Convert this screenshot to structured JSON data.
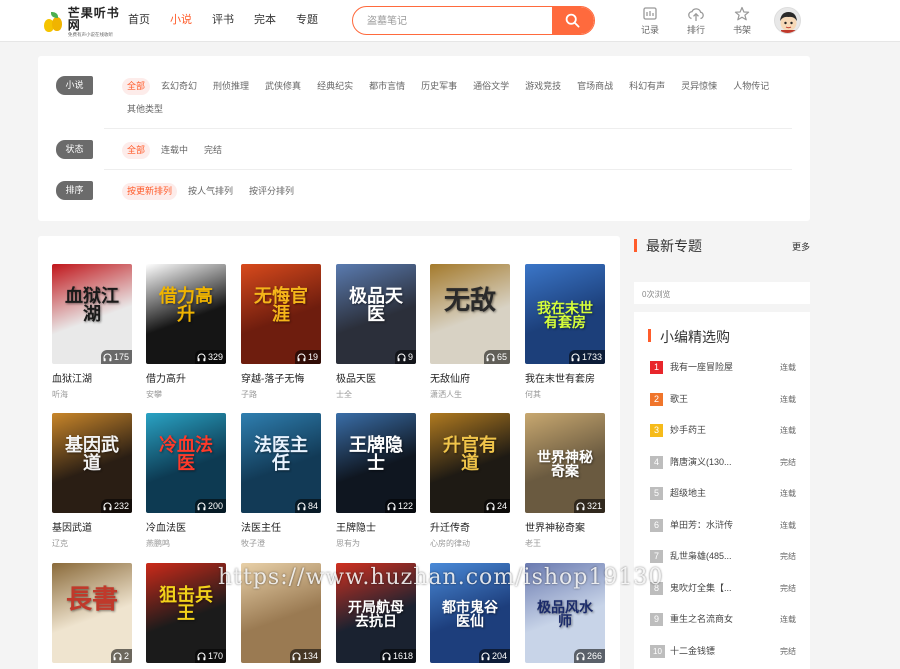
{
  "header": {
    "logo": {
      "title": "芒果听书网",
      "subtitle": "免费有声小说在线收听"
    },
    "nav": [
      {
        "label": "首页",
        "active": false
      },
      {
        "label": "小说",
        "active": true
      },
      {
        "label": "评书",
        "active": false
      },
      {
        "label": "完本",
        "active": false
      },
      {
        "label": "专题",
        "active": false
      }
    ],
    "search": {
      "placeholder": "盗墓笔记"
    },
    "tools": [
      {
        "label": "记录",
        "icon": "history-icon"
      },
      {
        "label": "排行",
        "icon": "upload-icon"
      },
      {
        "label": "书架",
        "icon": "star-icon"
      }
    ]
  },
  "filters": {
    "category": {
      "label": "小说",
      "options": [
        "全部",
        "玄幻奇幻",
        "刑侦推理",
        "武侠修真",
        "经典纪实",
        "都市言情",
        "历史军事",
        "通俗文学",
        "游戏竞技",
        "官场商战",
        "科幻有声",
        "灵异惊悚",
        "人物传记",
        "其他类型"
      ]
    },
    "status": {
      "label": "状态",
      "options": [
        "全部",
        "连载中",
        "完结"
      ]
    },
    "sort": {
      "label": "排序",
      "options": [
        "按更新排列",
        "按人气排列",
        "按评分排列"
      ]
    }
  },
  "books": [
    {
      "title": "血狱江湖",
      "author": "听海",
      "count": "175",
      "cover_text": "血狱江湖",
      "bg": "#e9e9e9",
      "fg": "#1a1a1a",
      "accent": "#c0161b"
    },
    {
      "title": "借力高升",
      "author": "安攀",
      "count": "329",
      "cover_text": "借力高升",
      "bg": "#151515",
      "fg": "#f0b400",
      "accent": "#ffffff"
    },
    {
      "title": "穿越-落子无悔",
      "author": "子路",
      "count": "19",
      "cover_text": "无悔官涯",
      "bg": "#6e1d0e",
      "fg": "#f5b51a",
      "accent": "#d84a1c"
    },
    {
      "title": "极品天医",
      "author": "士全",
      "count": "9",
      "cover_text": "极品天医",
      "bg": "#2b2f3a",
      "fg": "#ffffff",
      "accent": "#5a7bb0"
    },
    {
      "title": "无敌仙府",
      "author": "潇洒人生",
      "count": "65",
      "cover_text": "无敌",
      "bg": "#d8d2c4",
      "fg": "#2a2a2a",
      "accent": "#a47a2c"
    },
    {
      "title": "我在末世有套房",
      "author": "何其",
      "count": "1733",
      "cover_text": "我在末世有套房",
      "bg": "#1c3f7a",
      "fg": "#d6ff3a",
      "accent": "#3b76c8"
    },
    {
      "title": "基因武道",
      "author": "辽克",
      "count": "232",
      "cover_text": "基因武道",
      "bg": "#2a1e14",
      "fg": "#f3f3f3",
      "accent": "#c9862a"
    },
    {
      "title": "冷血法医",
      "author": "燕鹏鸣",
      "count": "200",
      "cover_text": "冷血法医",
      "bg": "#0d3a52",
      "fg": "#ff3a2a",
      "accent": "#2aa3c4"
    },
    {
      "title": "法医主任",
      "author": "牧子澄",
      "count": "84",
      "cover_text": "法医主任",
      "bg": "#123a56",
      "fg": "#e8f3ff",
      "accent": "#2f7fb0"
    },
    {
      "title": "王牌隐士",
      "author": "思有为",
      "count": "122",
      "cover_text": "王牌隐士",
      "bg": "#0f1620",
      "fg": "#ffffff",
      "accent": "#3a6ea8"
    },
    {
      "title": "升迁传奇",
      "author": "心房的律动",
      "count": "24",
      "cover_text": "升官有道",
      "bg": "#1e1a14",
      "fg": "#f0c44a",
      "accent": "#b07a20"
    },
    {
      "title": "世界神秘奇案",
      "author": "老王",
      "count": "321",
      "cover_text": "世界神秘奇案",
      "bg": "#6a5a40",
      "fg": "#ffffff",
      "accent": "#c8a870"
    },
    {
      "title": "",
      "author": "",
      "count": "2",
      "cover_text": "長書",
      "bg": "#efe4cf",
      "fg": "#c0392b",
      "accent": "#8a6a3a"
    },
    {
      "title": "",
      "author": "",
      "count": "170",
      "cover_text": "狙击兵王",
      "bg": "#1b1b1b",
      "fg": "#f2d21a",
      "accent": "#cc2a1a"
    },
    {
      "title": "",
      "author": "",
      "count": "134",
      "cover_text": "",
      "bg": "#9a7a52",
      "fg": "#2a1a10",
      "accent": "#e8d0a8"
    },
    {
      "title": "",
      "author": "",
      "count": "1618",
      "cover_text": "开局航母去抗日",
      "bg": "#1a2230",
      "fg": "#ffffff",
      "accent": "#d03020"
    },
    {
      "title": "",
      "author": "",
      "count": "204",
      "cover_text": "都市鬼谷医仙",
      "bg": "#1d3e7c",
      "fg": "#ffffff",
      "accent": "#4a8ad8"
    },
    {
      "title": "",
      "author": "",
      "count": "266",
      "cover_text": "极品风水师",
      "bg": "#c8d4e8",
      "fg": "#1a2a6a",
      "accent": "#6a7ab0"
    }
  ],
  "sidebar": {
    "topics_title": "最新专题",
    "topics_more": "更多",
    "topic_views": "0次浏览",
    "picks_title": "小编精选购",
    "picks": [
      {
        "rank": "1",
        "name": "我有一座冒险屋",
        "status": "连载",
        "color": "#e8262b"
      },
      {
        "rank": "2",
        "name": "歌王",
        "status": "连载",
        "color": "#f0752b"
      },
      {
        "rank": "3",
        "name": "妙手药王",
        "status": "连载",
        "color": "#f6bb1a"
      },
      {
        "rank": "4",
        "name": "隋唐演义(130...",
        "status": "完结",
        "color": "#bdbdbd"
      },
      {
        "rank": "5",
        "name": "超级地主",
        "status": "连载",
        "color": "#bdbdbd"
      },
      {
        "rank": "6",
        "name": "单田芳：水浒传",
        "status": "连载",
        "color": "#bdbdbd"
      },
      {
        "rank": "7",
        "name": "乱世枭雄(485...",
        "status": "完结",
        "color": "#bdbdbd"
      },
      {
        "rank": "8",
        "name": "鬼吹灯全集【...",
        "status": "完结",
        "color": "#bdbdbd"
      },
      {
        "rank": "9",
        "name": "重生之名流商女",
        "status": "连载",
        "color": "#bdbdbd"
      },
      {
        "rank": "10",
        "name": "十二金钱镖",
        "status": "完结",
        "color": "#bdbdbd"
      }
    ]
  },
  "watermark": "https://www.huzhan.com/ishop19130"
}
